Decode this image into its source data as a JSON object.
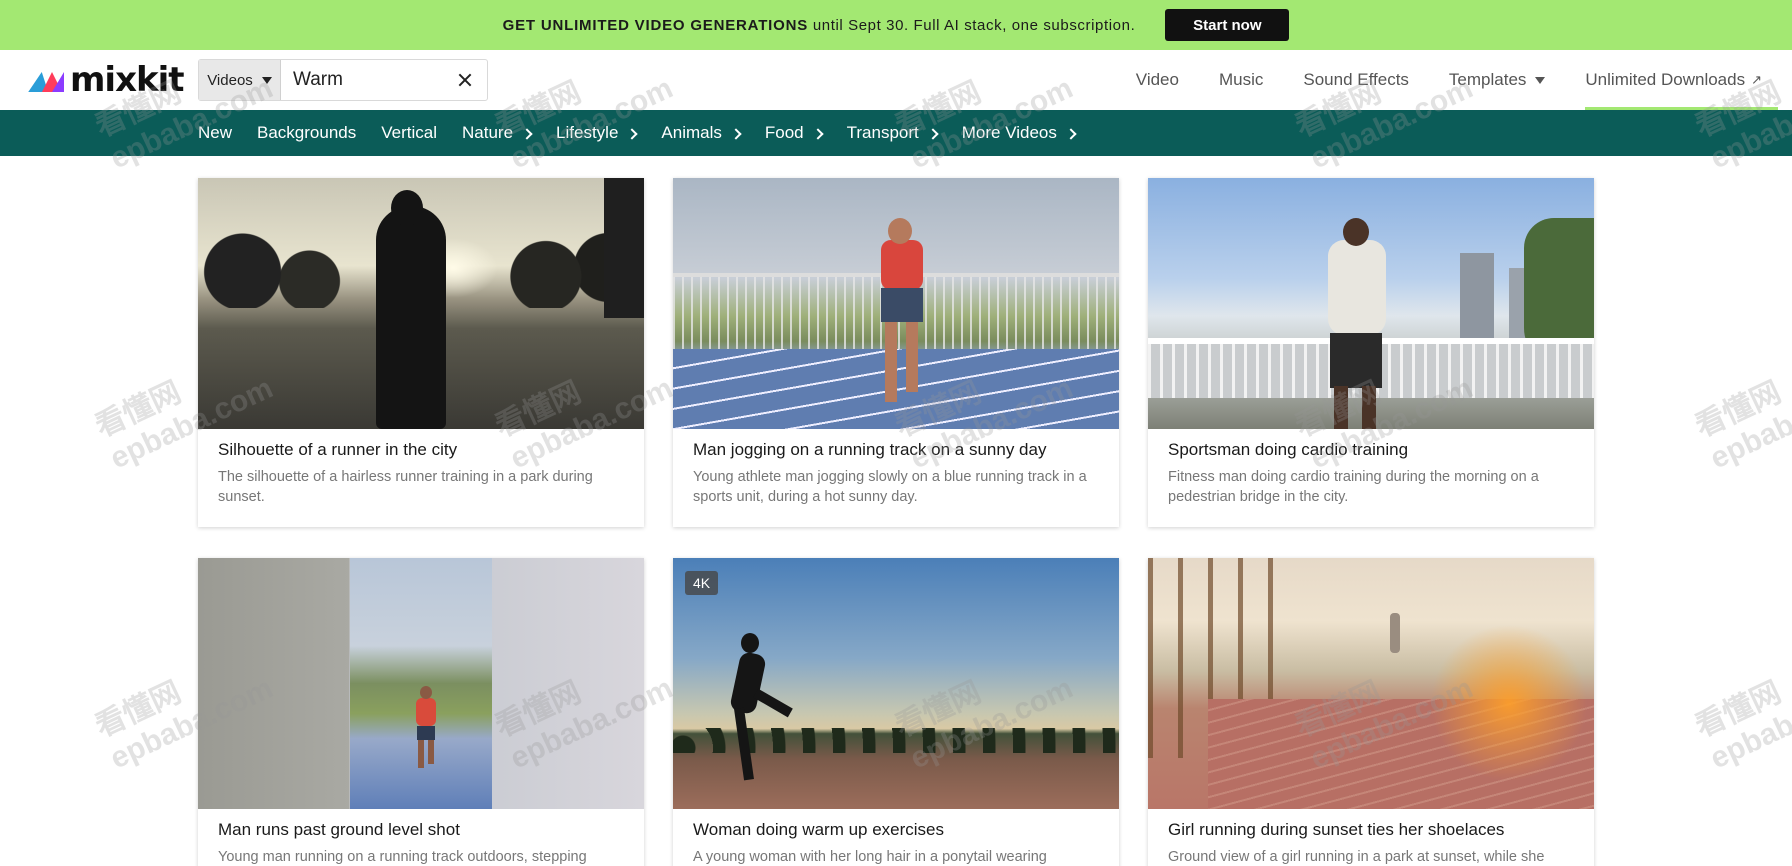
{
  "promo": {
    "bold_text": "GET UNLIMITED VIDEO GENERATIONS",
    "text": "until Sept 30. Full AI stack, one subscription.",
    "cta_label": "Start now"
  },
  "header": {
    "logo_text": "mixkit",
    "search": {
      "type_label": "Videos",
      "value": "Warm"
    },
    "nav": [
      {
        "label": "Video"
      },
      {
        "label": "Music"
      },
      {
        "label": "Sound Effects"
      },
      {
        "label": "Templates"
      },
      {
        "label": "Unlimited Downloads"
      }
    ]
  },
  "categories": [
    {
      "label": "New",
      "has_chevron": false
    },
    {
      "label": "Backgrounds",
      "has_chevron": false
    },
    {
      "label": "Vertical",
      "has_chevron": false
    },
    {
      "label": "Nature",
      "has_chevron": true
    },
    {
      "label": "Lifestyle",
      "has_chevron": true
    },
    {
      "label": "Animals",
      "has_chevron": true
    },
    {
      "label": "Food",
      "has_chevron": true
    },
    {
      "label": "Transport",
      "has_chevron": true
    },
    {
      "label": "More Videos",
      "has_chevron": true
    }
  ],
  "videos": [
    {
      "title": "Silhouette of a runner in the city",
      "description": "The silhouette of a hairless runner training in a park during sunset."
    },
    {
      "title": "Man jogging on a running track on a sunny day",
      "description": "Young athlete man jogging slowly on a blue running track in a sports unit, during a hot sunny day."
    },
    {
      "title": "Sportsman doing cardio training",
      "description": "Fitness man doing cardio training during the morning on a pedestrian bridge in the city."
    },
    {
      "title": "Man runs past ground level shot",
      "description": "Young man running on a running track outdoors, stepping"
    },
    {
      "title": "Woman doing warm up exercises",
      "description": "A young woman with her long hair in a ponytail wearing",
      "badge": "4K"
    },
    {
      "title": "Girl running during sunset ties her shoelaces",
      "description": "Ground view of a girl running in a park at sunset, while she"
    }
  ],
  "watermark": {
    "line1": "看懂网",
    "line2": "epbaba.com"
  },
  "colors": {
    "promo_bg": "#a3e872",
    "category_bar_bg": "#0b5c58",
    "accent_underline": "#a3e872"
  }
}
